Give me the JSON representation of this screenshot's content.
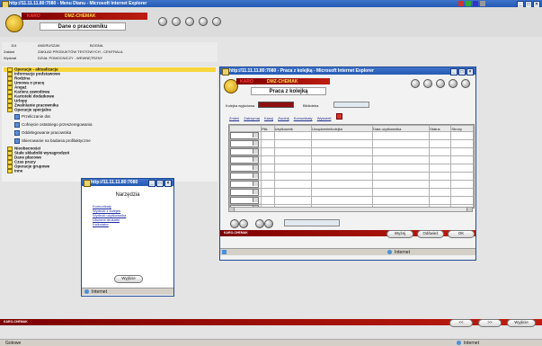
{
  "main_window": {
    "title": "http://11.11.11.80:7080 - Menu Dianu - Microsoft Internet Explorer",
    "app_name": "DMZ-CHEMAK",
    "brand": "KARO",
    "page_title": "Dane o pracowniku",
    "employee": {
      "id": "114",
      "last_name": "ANDRUSZAK",
      "first_name": "BOGNA",
      "dept_label": "Zakład",
      "dept_value": "ZAKŁAD PRODUKTÓW TESTOWYCH - CENTRALA",
      "div_label": "Wydział",
      "div_value": "DZIAŁ POMOCNICZY - WEWNĘTRZNY"
    },
    "side_menu": [
      "Operacje - aktualizacja",
      "Informacje podstawowe",
      "Rodzina",
      "Umowa o pracę",
      "Angaż",
      "Kariera zawodowa",
      "Kartoteki dodatkowe",
      "Urlopy",
      "Zwalnianie pracownika",
      "Operacje specjalne"
    ],
    "sub_menu": [
      "Przeliczanie dat",
      "Cofnięcie ostatniego przeszeregowania",
      "Oddelegowanie pracownika",
      "Skierowanie na badania profilaktyczne"
    ],
    "side_menu_2": [
      "Nieobecności",
      "Stałe składniki wynagrodzeń",
      "Dane płacowe",
      "Czas pracy",
      "Operacje grupowe",
      "Inne"
    ],
    "footer_brand": "KARO-CHEMAK",
    "buttons": {
      "prev": "<<",
      "next": ">>",
      "exit": "Wyjście"
    }
  },
  "job_window": {
    "title": "http://11.11.11.80:7080 - Praca z kolejką - Microsoft Internet Explorer",
    "app_name": "DMZ-CHEMAK",
    "brand": "KARO",
    "page_title": "Praca z kolejką",
    "queue_label": "Kolejka wyjściowa",
    "library_label": "Biblioteka",
    "tabs": [
      "Zmień",
      "Zatrzymaj",
      "Kasuj",
      "Zwolnij",
      "Komunikaty",
      "Wyświetl"
    ],
    "columns": [
      "Plik",
      "Użytkownik",
      "Urządzenie/kolejka",
      "Data użytkownika",
      "Status",
      "Strony"
    ],
    "buttons": {
      "refresh": "Wyżej",
      "back": "Odśwież",
      "ok": "OK"
    },
    "footer_brand": "KARO-CHEMAK",
    "status_zone": "Internet"
  },
  "tools_window": {
    "title": "http://11.11.11.80:7080",
    "heading": "Narzędzia",
    "links": [
      "Komunikaty",
      "Wydruki z kolejek",
      "Wydruki użytkownika",
      "Ułożone drukarki",
      "Kalkulator"
    ],
    "exit": "Wyjście",
    "status_zone": "Internet"
  },
  "taskbar": {
    "start": "Gotowe",
    "zone": "Internet"
  }
}
